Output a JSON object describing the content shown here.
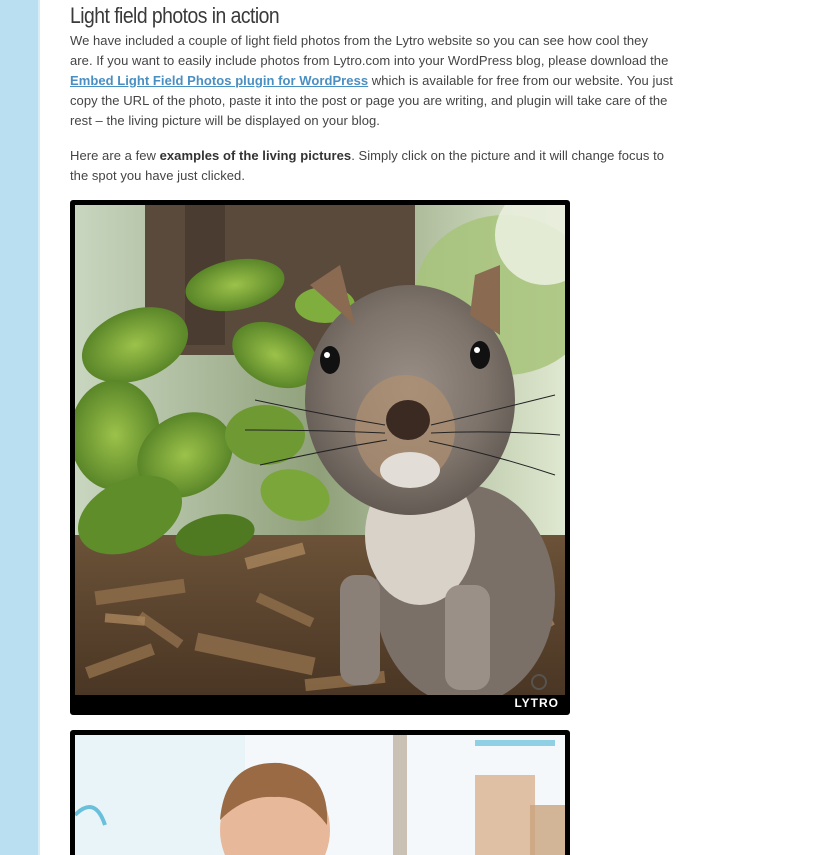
{
  "article": {
    "heading": "Light field photos in action",
    "para1_before_link": "We have included a couple of light field photos from the Lytro website so you can see how cool they are. If you want to easily include photos from Lytro.com into your WordPress blog, please download the ",
    "plugin_link_text": "Embed Light Field Photos plugin for WordPress",
    "para1_after_link": " which is available for free from our website. You just copy the URL of the photo, paste it into the post or page you are writing, and plugin will take care of the rest – the living picture will be displayed on your blog.",
    "para2_before_bold": "Here are a few ",
    "para2_bold": "examples of the living pictures",
    "para2_after_bold": ". Simply click on the picture and it will change focus to the spot you have just clicked."
  },
  "photos": [
    {
      "subject": "squirrel",
      "brand": "LYTRO",
      "icon": "focus-icon"
    },
    {
      "subject": "child",
      "brand": "",
      "icon": ""
    }
  ],
  "colors": {
    "sidebar": "#b9dff1",
    "link": "#4a8fc2",
    "text": "#444444",
    "heading": "#3a3a3a"
  }
}
